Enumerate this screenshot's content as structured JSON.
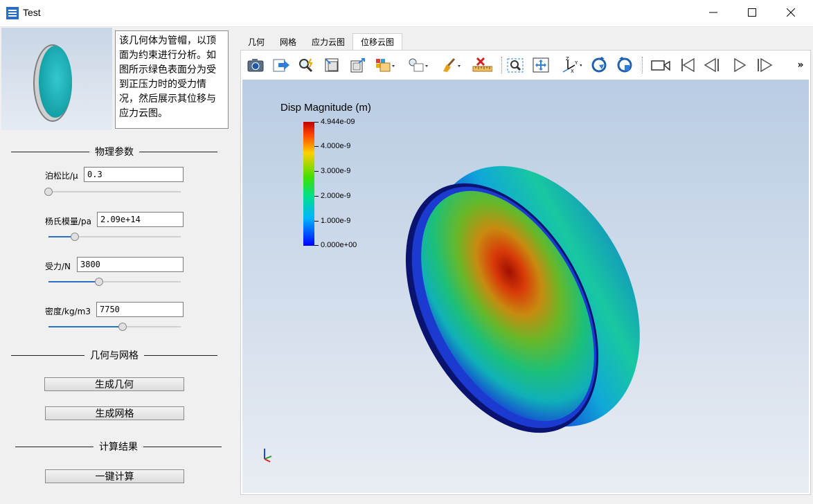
{
  "window": {
    "title": "Test"
  },
  "description": "该几何体为管帽，以顶面为约束进行分析。如图所示绿色表面分为受到正压力时的受力情况，然后展示其位移与应力云图。",
  "sections": {
    "physics": "物理参数",
    "geometry_mesh": "几何与网格",
    "results": "计算结果"
  },
  "params": {
    "poisson": {
      "label": "泊松比/μ",
      "value": "0.3",
      "level": 0.0
    },
    "youngs": {
      "label": "杨氏模量/pa",
      "value": "2.09e+14",
      "level": 0.2
    },
    "force": {
      "label": "受力/N",
      "value": "3800",
      "level": 0.38
    },
    "density": {
      "label": "密度/kg/m3",
      "value": "7750",
      "level": 0.56
    }
  },
  "buttons": {
    "gen_geometry": "生成几何",
    "gen_mesh": "生成网格",
    "compute": "一键计算"
  },
  "tabs": [
    {
      "label": "几何",
      "active": false
    },
    {
      "label": "网格",
      "active": false
    },
    {
      "label": "应力云图",
      "active": false
    },
    {
      "label": "位移云图",
      "active": true
    }
  ],
  "toolbar": {
    "icons": [
      "camera-icon",
      "export-icon",
      "probe-icon",
      "fit-box-icon",
      "box-select-icon",
      "render-mode-icon",
      "light-icon",
      "clear-icon",
      "ruler-delete-icon",
      "zoom-region-icon",
      "fit-view-icon",
      "axes-icon",
      "rotate-cw-icon",
      "rotate-ccw-icon",
      "video-icon",
      "first-frame-icon",
      "prev-frame-icon",
      "play-icon",
      "last-frame-icon"
    ],
    "overflow": "»"
  },
  "colorbar": {
    "title": "Disp Magnitude (m)",
    "ticks": [
      "4.944e-09",
      "4.000e-9",
      "3.000e-9",
      "2.000e-9",
      "1.000e-9",
      "0.000e+00"
    ],
    "max": 4.944e-09,
    "min": 0
  },
  "colors": {
    "accent": "#2a6fc4",
    "max": "#c00000",
    "min": "#0000ff"
  }
}
